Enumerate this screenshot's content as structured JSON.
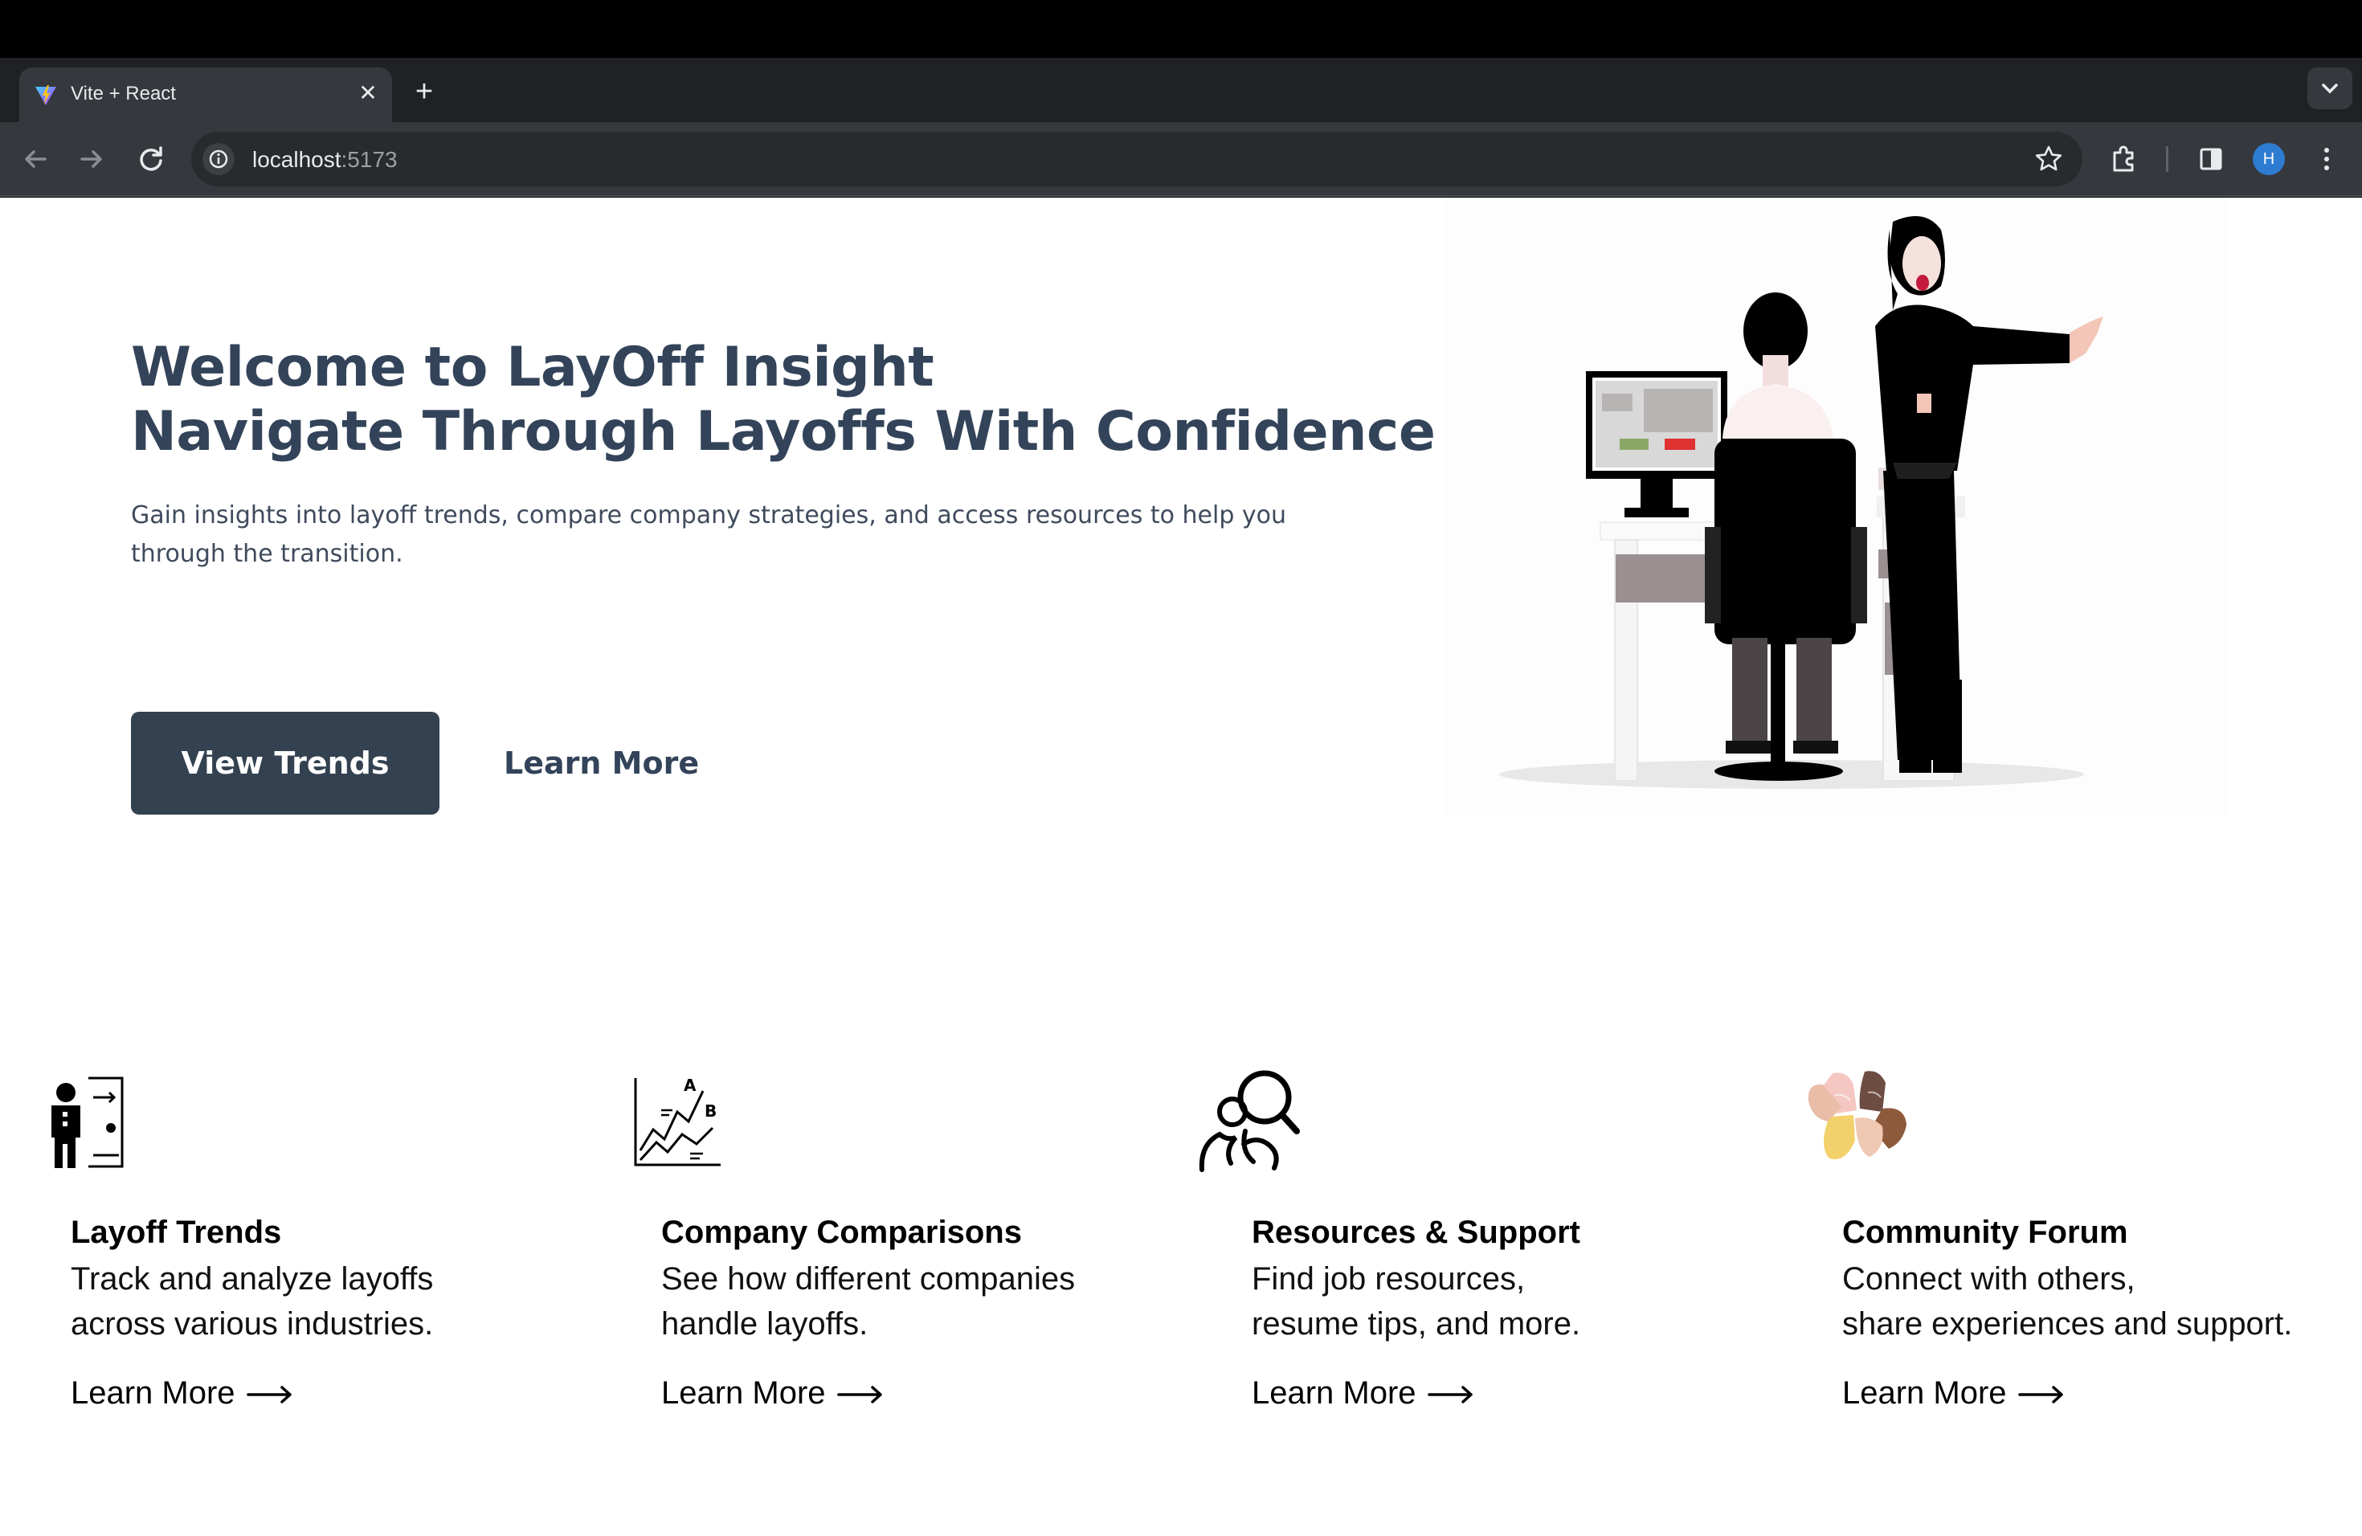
{
  "browser": {
    "tab_title": "Vite + React",
    "url_host": "localhost",
    "url_port": ":5173",
    "profile_initial": "H"
  },
  "hero": {
    "title_line1": "Welcome to LayOff Insight",
    "title_line2": "Navigate Through Layoffs With Confidence",
    "subtitle": "Gain insights into layoff trends, compare company strategies, and access resources to help you through the transition.",
    "primary_button": "View Trends",
    "secondary_button": "Learn More",
    "title_color": "#334359",
    "button_color": "#334150"
  },
  "features": [
    {
      "icon": "presenter-chart-icon",
      "title": "Layoff Trends",
      "desc_line1": "Track and analyze layoffs",
      "desc_line2": "across various industries.",
      "link": "Learn More"
    },
    {
      "icon": "ab-chart-icon",
      "title": "Company Comparisons",
      "desc_line1": "See how different companies",
      "desc_line2": "handle layoffs.",
      "link": "Learn More"
    },
    {
      "icon": "people-search-icon",
      "title": "Resources & Support",
      "desc_line1": "Find job resources,",
      "desc_line2": "resume tips, and more.",
      "link": "Learn More"
    },
    {
      "icon": "joined-hands-icon",
      "title": "Community Forum",
      "desc_line1": "Connect with others,",
      "desc_line2": "share experiences and support.",
      "link": "Learn More"
    }
  ]
}
